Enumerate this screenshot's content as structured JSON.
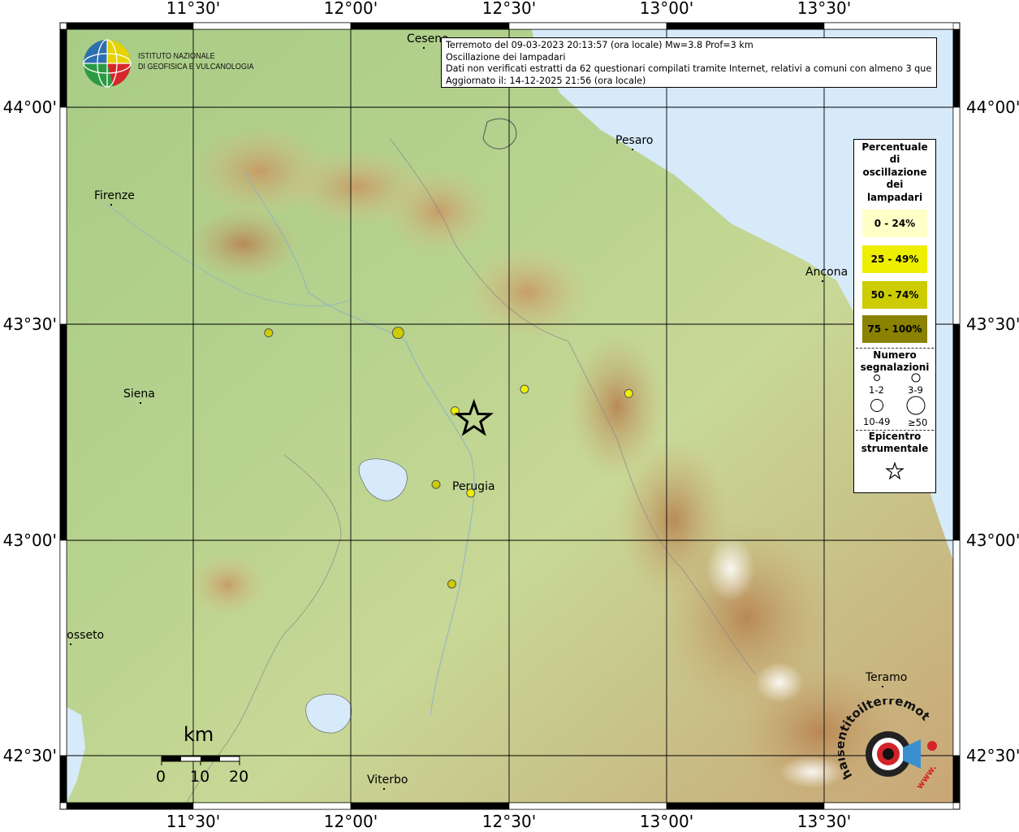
{
  "header": {
    "line1": "Terremoto del 09-03-2023 20:13:57 (ora locale) Mw=3.8 Prof=3 km",
    "line2": "Oscillazione dei lampadari",
    "line3": "Dati non verificati estratti da 62 questionari compilati tramite Internet, relativi a comuni con almeno 3 questionari.",
    "line4": "Aggiornato il: 14-12-2025 21:56 (ora locale)"
  },
  "institute": {
    "line1": "ISTITUTO NAZIONALE",
    "line2": "DI GEOFISICA E VULCANOLOGIA"
  },
  "axes": {
    "longitude_ticks": [
      "11°30'",
      "12°00'",
      "12°30'",
      "13°00'",
      "13°30'"
    ],
    "latitude_ticks": [
      "44°00'",
      "43°30'",
      "43°00'",
      "42°30'"
    ]
  },
  "cities": [
    {
      "name": "Cesena"
    },
    {
      "name": "Pesaro"
    },
    {
      "name": "Firenze"
    },
    {
      "name": "Ancona"
    },
    {
      "name": "Siena"
    },
    {
      "name": "Perugia"
    },
    {
      "name": "Grosseto"
    },
    {
      "name": "Teramo"
    },
    {
      "name": "Viterbo"
    }
  ],
  "legend": {
    "title": "Percentuale di oscillazione dei lampadari",
    "classes": [
      {
        "label": "0 - 24%",
        "color": "#ffffc8"
      },
      {
        "label": "25 - 49%",
        "color": "#eeee00"
      },
      {
        "label": "50 - 74%",
        "color": "#cccc00"
      },
      {
        "label": "75 - 100%",
        "color": "#8a8200"
      }
    ],
    "count_title": "Numero segnalazioni",
    "count_classes": [
      "1-2",
      "3-9",
      "10-49",
      "≥50"
    ],
    "epicenter_title": "Epicentro strumentale"
  },
  "scale_bar": {
    "unit": "km",
    "ticks": [
      "0",
      "10",
      "20"
    ]
  },
  "observations": [
    {
      "lon": 11.74,
      "lat": 43.48,
      "percent_class": "50 - 74%",
      "count_class": "3-9"
    },
    {
      "lon": 12.15,
      "lat": 43.48,
      "percent_class": "50 - 74%",
      "count_class": "10-49"
    },
    {
      "lon": 12.55,
      "lat": 43.35,
      "percent_class": "25 - 49%",
      "count_class": "3-9"
    },
    {
      "lon": 12.88,
      "lat": 43.34,
      "percent_class": "25 - 49%",
      "count_class": "3-9"
    },
    {
      "lon": 12.33,
      "lat": 43.3,
      "percent_class": "25 - 49%",
      "count_class": "3-9"
    },
    {
      "lon": 12.27,
      "lat": 43.13,
      "percent_class": "50 - 74%",
      "count_class": "3-9"
    },
    {
      "lon": 12.38,
      "lat": 43.11,
      "percent_class": "25 - 49%",
      "count_class": "3-9"
    },
    {
      "lon": 12.32,
      "lat": 42.9,
      "percent_class": "50 - 74%",
      "count_class": "3-9"
    }
  ],
  "epicenter": {
    "lon": 12.39,
    "lat": 43.28
  },
  "hsi_logo": {
    "text": "haisentitoilterremoto.it",
    "url_text": "www."
  }
}
